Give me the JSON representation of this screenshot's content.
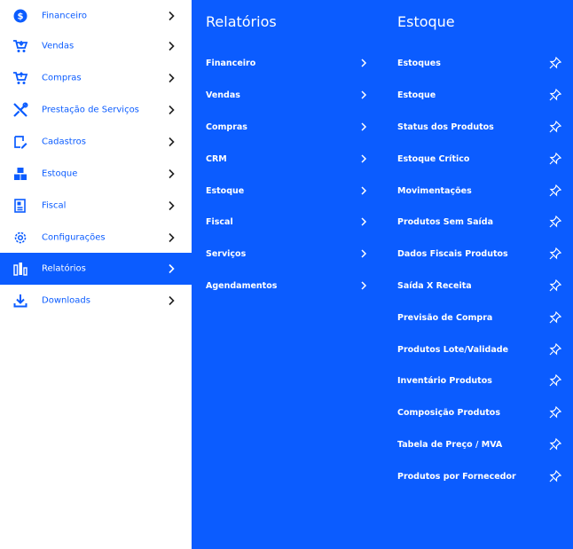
{
  "sidebar": {
    "items": [
      {
        "label": "Financeiro",
        "icon": "dollar-circle-icon"
      },
      {
        "label": "Vendas",
        "icon": "cart-icon"
      },
      {
        "label": "Compras",
        "icon": "cart-add-icon"
      },
      {
        "label": "Prestação de Serviços",
        "icon": "tools-icon"
      },
      {
        "label": "Cadastros",
        "icon": "edit-note-icon"
      },
      {
        "label": "Estoque",
        "icon": "boxes-icon"
      },
      {
        "label": "Fiscal",
        "icon": "receipt-icon"
      },
      {
        "label": "Configurações",
        "icon": "gear-icon"
      },
      {
        "label": "Relatórios",
        "icon": "bar-chart-icon"
      },
      {
        "label": "Downloads",
        "icon": "download-icon"
      }
    ],
    "active": "Relatórios"
  },
  "reports": {
    "title": "Relatórios",
    "items": [
      "Financeiro",
      "Vendas",
      "Compras",
      "CRM",
      "Estoque",
      "Fiscal",
      "Serviços",
      "Agendamentos"
    ]
  },
  "stock": {
    "title": "Estoque",
    "items": [
      "Estoques",
      "Estoque",
      "Status dos Produtos",
      "Estoque Crítico",
      "Movimentações",
      "Produtos Sem Saída",
      "Dados Fiscais Produtos",
      "Saída X Receita",
      "Previsão de Compra",
      "Produtos Lote/Validade",
      "Inventário Produtos",
      "Composição Produtos",
      "Tabela de Preço / MVA",
      "Produtos por Fornecedor"
    ]
  },
  "colors": {
    "accent": "#0b5cff",
    "background": "#ffffff",
    "panel_text": "#ffffff"
  }
}
